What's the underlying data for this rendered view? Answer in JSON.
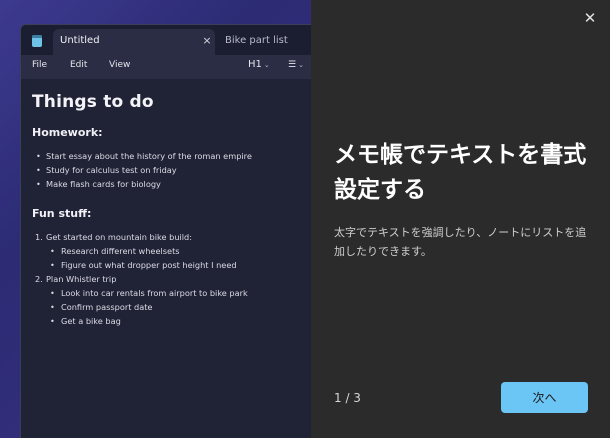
{
  "notepad": {
    "tabs": [
      {
        "label": "Untitled",
        "active": true,
        "close_icon": "×"
      },
      {
        "label": "Bike part list",
        "active": false
      }
    ],
    "menu": {
      "file": "File",
      "edit": "Edit",
      "view": "View",
      "heading": "H1",
      "heading_chevron": "⌄",
      "list_icon": "☰",
      "list_chevron": "⌄"
    },
    "document": {
      "title": "Things to do",
      "homework_heading": "Homework:",
      "homework_items": [
        "Start essay about the history of the roman empire",
        "Study for calculus test on friday",
        "Make flash cards for biology"
      ],
      "fun_heading": "Fun stuff:",
      "fun_items": [
        {
          "number": "1.",
          "text": "Get started on mountain bike build:",
          "sub": [
            "Research different wheelsets",
            "Figure out what dropper post height I need"
          ]
        },
        {
          "number": "2.",
          "text": "Plan Whistler trip",
          "sub": [
            "Look into car rentals from airport to bike park",
            "Confirm passport date",
            "Get a bike bag"
          ]
        }
      ]
    }
  },
  "panel": {
    "close_label": "✕",
    "title": "メモ帳でテキストを書式設定する",
    "description": "太字でテキストを強調したり、ノートにリストを追加したりできます。",
    "page_counter": "1 / 3",
    "next_label": "次へ"
  },
  "colors": {
    "next_button": "#6cc6f5",
    "panel_background": "#2b2b2b",
    "backdrop": "#3d3a8f"
  }
}
